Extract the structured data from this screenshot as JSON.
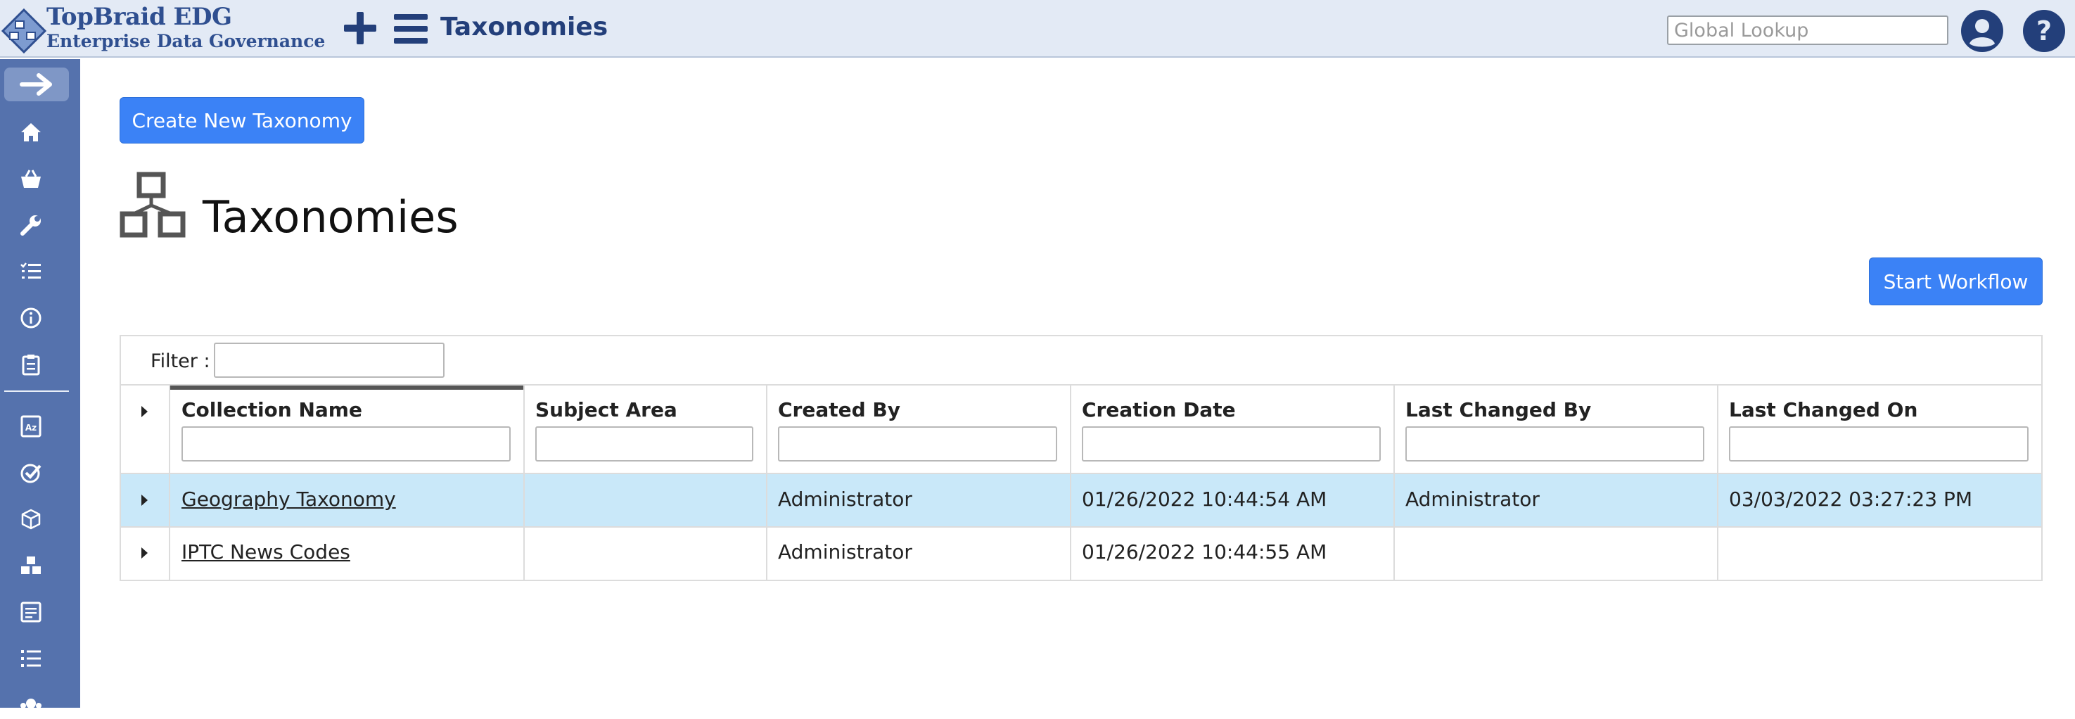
{
  "header": {
    "logo_title": "TopBraid EDG",
    "logo_subtitle": "Enterprise Data Governance",
    "page_title": "Taxonomies",
    "global_lookup_placeholder": "Global Lookup",
    "icons": [
      "logo-diamond-icon",
      "plus-icon",
      "hamburger-menu-icon",
      "user-circle-icon",
      "help-circle-icon"
    ]
  },
  "sidebar": {
    "toggle_icon": "arrow-right-icon",
    "items": [
      {
        "icon": "home-icon"
      },
      {
        "icon": "basket-icon"
      },
      {
        "icon": "wrench-icon"
      },
      {
        "icon": "task-list-icon"
      },
      {
        "icon": "info-circle-icon"
      },
      {
        "icon": "clipboard-icon"
      },
      {
        "icon": "dictionary-az-icon"
      },
      {
        "icon": "check-circle-icon"
      },
      {
        "icon": "cube-icon"
      },
      {
        "icon": "cubes-icon"
      },
      {
        "icon": "document-icon"
      },
      {
        "icon": "numbered-list-icon"
      },
      {
        "icon": "group-icon"
      }
    ]
  },
  "main": {
    "create_button": "Create New Taxonomy",
    "title": "Taxonomies",
    "workflow_button": "Start Workflow",
    "filter_label": "Filter :",
    "columns": [
      "Collection Name",
      "Subject Area",
      "Created By",
      "Creation Date",
      "Last Changed By",
      "Last Changed On"
    ],
    "rows": [
      {
        "collection_name": "Geography Taxonomy",
        "subject_area": "",
        "created_by": "Administrator",
        "creation_date": "01/26/2022 10:44:54 AM",
        "last_changed_by": "Administrator",
        "last_changed_on": "03/03/2022 03:27:23 PM",
        "selected": true
      },
      {
        "collection_name": "IPTC News Codes",
        "subject_area": "",
        "created_by": "Administrator",
        "creation_date": "01/26/2022 10:44:55 AM",
        "last_changed_by": "",
        "last_changed_on": "",
        "selected": false
      }
    ]
  },
  "colors": {
    "header_bg": "#e3eaf5",
    "sidebar_bg": "#5572ad",
    "brand_text": "#2f4f90",
    "primary_button": "#3b82f6",
    "selected_row": "#c9e8f9"
  }
}
